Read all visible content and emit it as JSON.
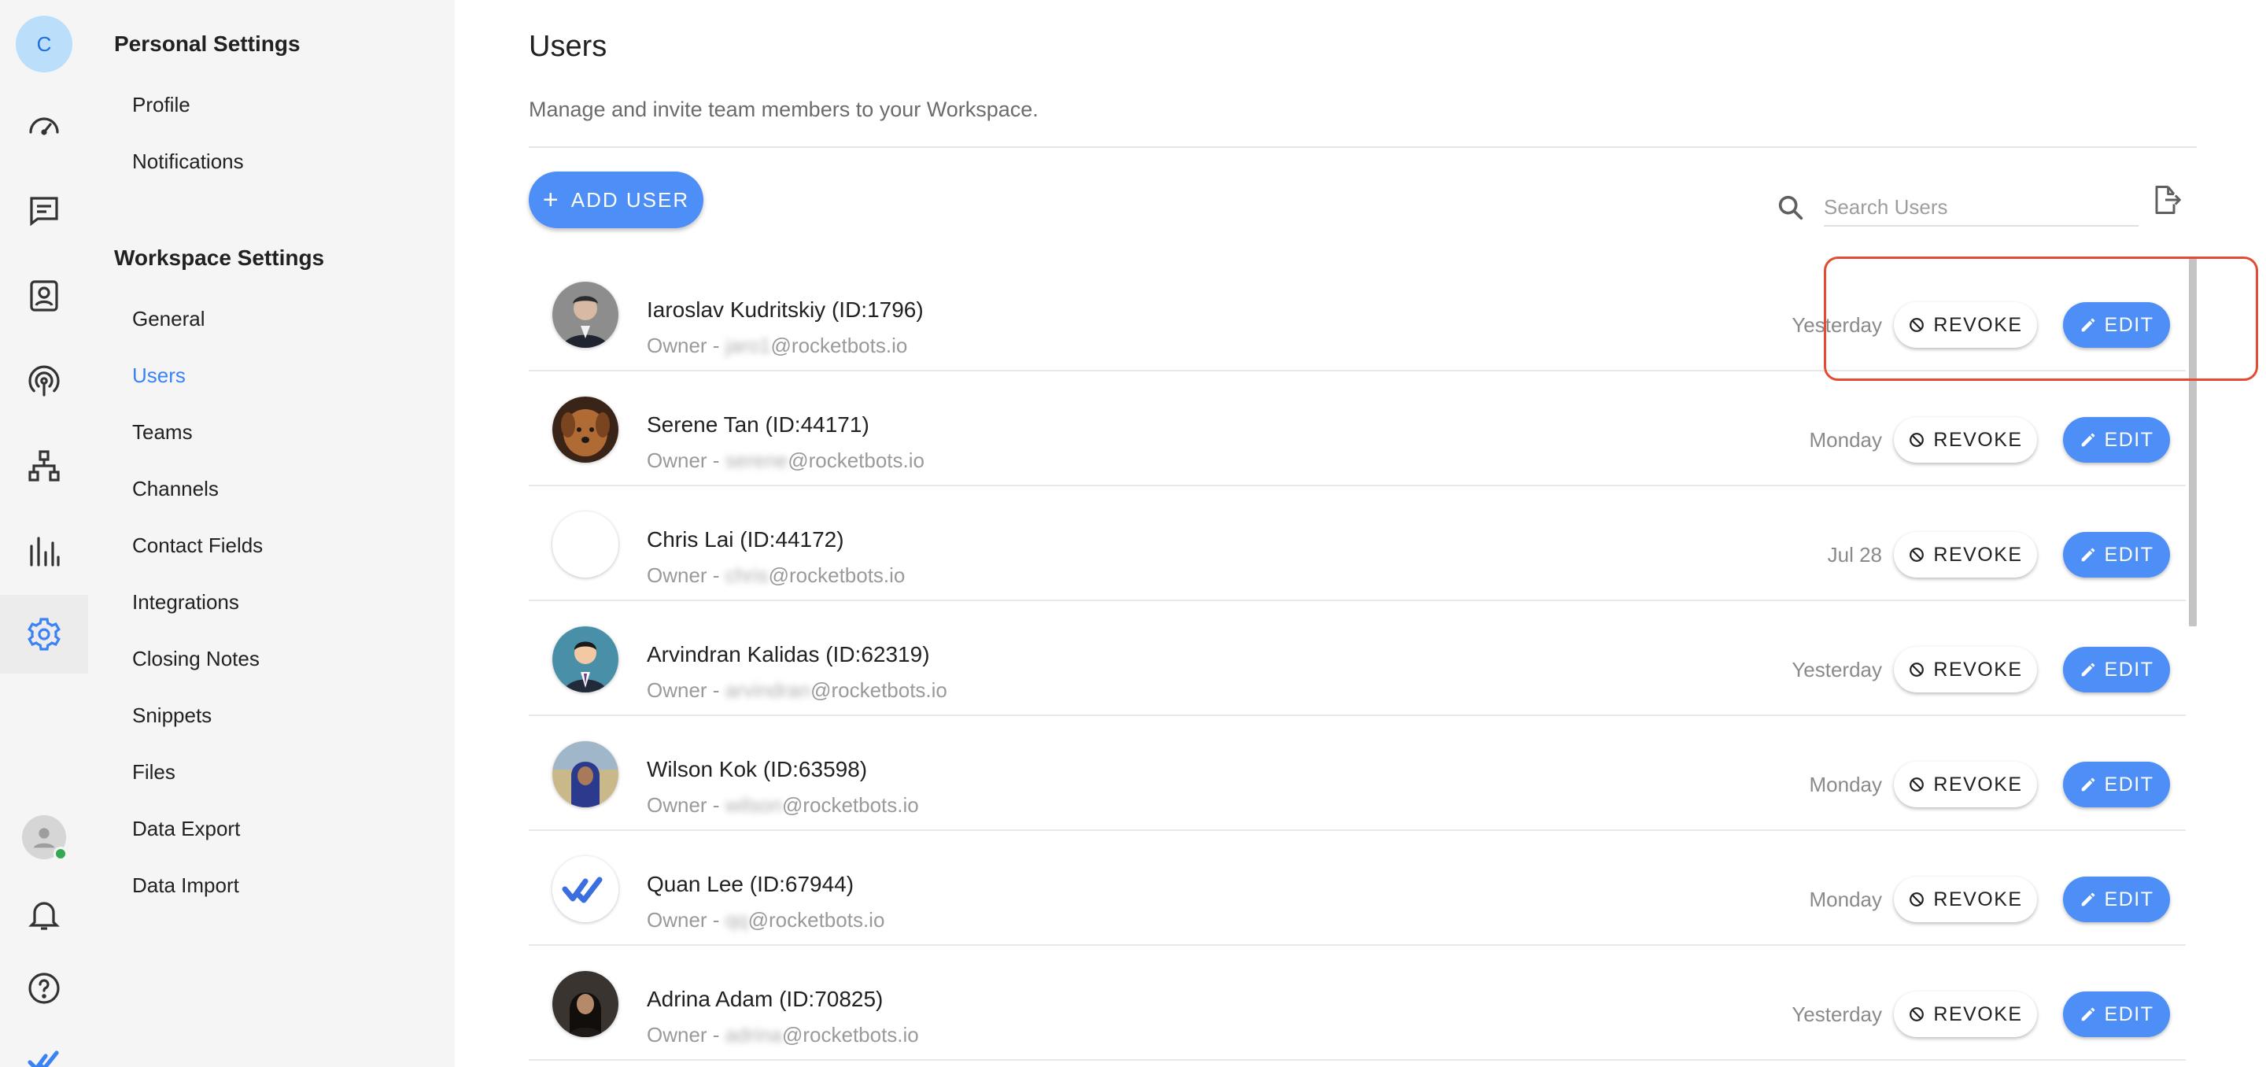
{
  "rail": {
    "avatar_initial": "C",
    "items": [
      {
        "icon": "speedometer-icon"
      },
      {
        "icon": "message-icon"
      },
      {
        "icon": "contact-card-icon"
      },
      {
        "icon": "broadcast-icon"
      },
      {
        "icon": "hierarchy-icon"
      },
      {
        "icon": "bar-chart-icon"
      },
      {
        "icon": "gear-icon"
      }
    ],
    "bottom": [
      {
        "icon": "user-avatar-icon"
      },
      {
        "icon": "bell-icon"
      },
      {
        "icon": "help-icon"
      },
      {
        "icon": "logo-icon"
      }
    ],
    "accent": "#3b82f6"
  },
  "settings": {
    "personal_title": "Personal Settings",
    "personal_items": [
      "Profile",
      "Notifications"
    ],
    "workspace_title": "Workspace Settings",
    "workspace_items": [
      "General",
      "Users",
      "Teams",
      "Channels",
      "Contact Fields",
      "Integrations",
      "Closing Notes",
      "Snippets",
      "Files",
      "Data Export",
      "Data Import"
    ],
    "active_item": "Users"
  },
  "main": {
    "title": "Users",
    "description": "Manage and invite team members to your Workspace.",
    "add_user_label": "ADD USER",
    "search_placeholder": "Search Users",
    "revoke_label": "REVOKE",
    "edit_label": "EDIT",
    "users": [
      {
        "name": "Iaroslav Kudritskiy (ID:1796)",
        "role": "Owner - ",
        "email_hidden": "jaro1",
        "email_domain": "@rocketbots.io",
        "last_seen": "Yesterday",
        "avatar": "photo-man-suit"
      },
      {
        "name": "Serene Tan (ID:44171)",
        "role": "Owner - ",
        "email_hidden": "serene",
        "email_domain": "@rocketbots.io",
        "last_seen": "Monday",
        "avatar": "photo-dog"
      },
      {
        "name": "Chris Lai (ID:44172)",
        "role": "Owner - ",
        "email_hidden": "chris",
        "email_domain": "@rocketbots.io",
        "last_seen": "Jul 28",
        "avatar": "blank"
      },
      {
        "name": "Arvindran Kalidas (ID:62319)",
        "role": "Owner - ",
        "email_hidden": "arvindran",
        "email_domain": "@rocketbots.io",
        "last_seen": "Yesterday",
        "avatar": "illustration-businessman"
      },
      {
        "name": "Wilson Kok (ID:63598)",
        "role": "Owner - ",
        "email_hidden": "wilson",
        "email_domain": "@rocketbots.io",
        "last_seen": "Monday",
        "avatar": "photo-hooded"
      },
      {
        "name": "Quan Lee (ID:67944)",
        "role": "Owner - ",
        "email_hidden": "qq",
        "email_domain": "@rocketbots.io",
        "last_seen": "Monday",
        "avatar": "logo-checkmarks"
      },
      {
        "name": "Adrina Adam (ID:70825)",
        "role": "Owner - ",
        "email_hidden": "adrina",
        "email_domain": "@rocketbots.io",
        "last_seen": "Yesterday",
        "avatar": "photo-woman-dark"
      }
    ],
    "highlight_color": "#e34b32",
    "primary_color": "#4d8ef7"
  }
}
